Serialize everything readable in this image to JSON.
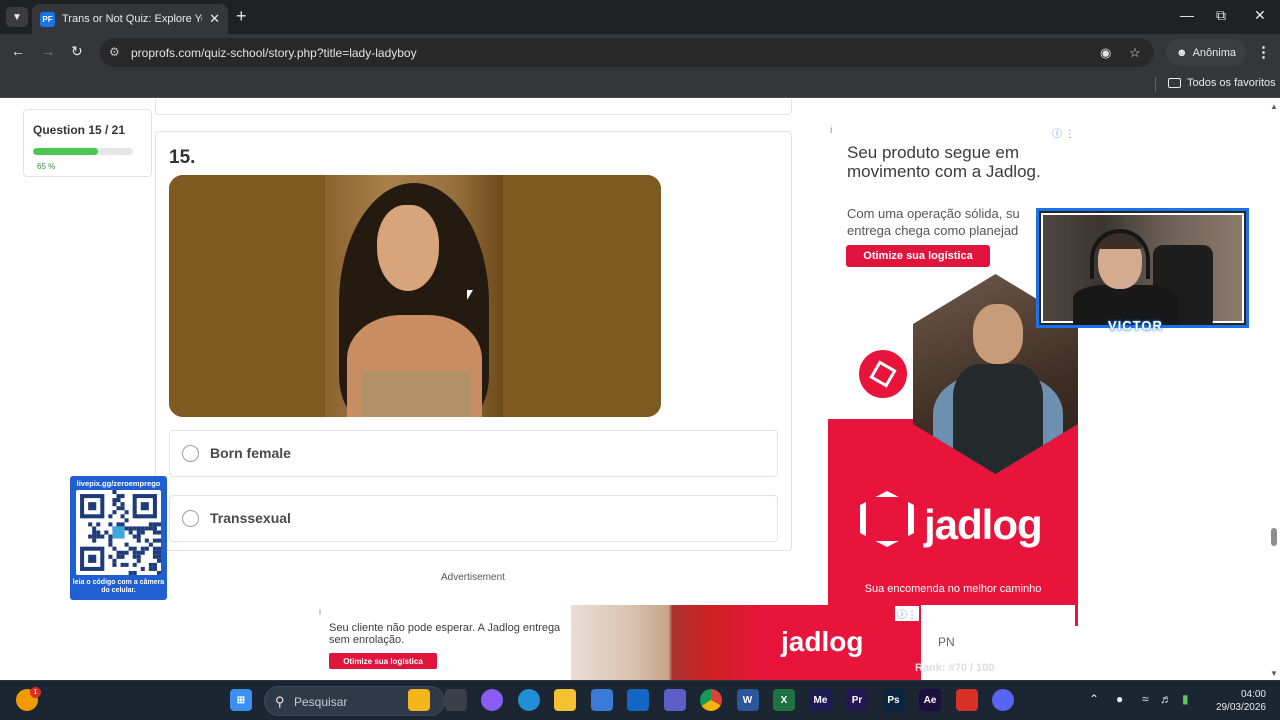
{
  "browser": {
    "tab_title": "Trans or Not Quiz: Explore Your",
    "favicon_text": "PF",
    "url": "proprofs.com/quiz-school/story.php?title=lady-ladyboy",
    "profile_label": "Anônima",
    "bookmarks_folder": "Todos os favoritos"
  },
  "quiz": {
    "progress_label": "Question 15 / 21",
    "progress_percent": 65,
    "progress_text": "65 %",
    "question_number": "15.",
    "answers": [
      "Born female",
      "Transsexual"
    ],
    "advertisement_label": "Advertisement"
  },
  "ad_right": {
    "headline": "Seu produto segue em movimento com a Jadlog.",
    "body_line1": "Com uma operação sólida, su",
    "body_line2": "entrega chega como planejad",
    "cta": "Otimize sua logística",
    "brand": "jadlog",
    "tagline": "Sua encomenda no melhor caminho",
    "accent": "#e8143c"
  },
  "webcam": {
    "name": "VICTOR"
  },
  "qr": {
    "url": "livepix.gg/zeroemprego",
    "caption": "leia o código com a câmera do celular."
  },
  "ad_bottom": {
    "text": "Seu cliente não pode esperar. A Jadlog entrega sem enrolação.",
    "cta": "Otimize sua logística",
    "brand": "jadlog",
    "side_text": "PN",
    "faded_text": "Rank: #70 / 100"
  },
  "taskbar": {
    "search_placeholder": "Pesquisar",
    "time": "04:00",
    "date": "29/03/2026",
    "notification_count": "1",
    "apps": [
      {
        "name": "lighthouse-app",
        "label": ""
      },
      {
        "name": "task-view",
        "label": ""
      },
      {
        "name": "copilot",
        "label": ""
      },
      {
        "name": "edge",
        "label": ""
      },
      {
        "name": "file-explorer",
        "label": ""
      },
      {
        "name": "store",
        "label": ""
      },
      {
        "name": "outlook",
        "label": ""
      },
      {
        "name": "teams",
        "label": ""
      },
      {
        "name": "chrome",
        "label": ""
      },
      {
        "name": "word",
        "label": "W"
      },
      {
        "name": "excel",
        "label": "X"
      },
      {
        "name": "media-encoder",
        "label": "Me"
      },
      {
        "name": "premiere",
        "label": "Pr"
      },
      {
        "name": "photoshop",
        "label": "Ps"
      },
      {
        "name": "after-effects",
        "label": "Ae"
      },
      {
        "name": "cards-app",
        "label": ""
      },
      {
        "name": "discord",
        "label": ""
      }
    ]
  }
}
